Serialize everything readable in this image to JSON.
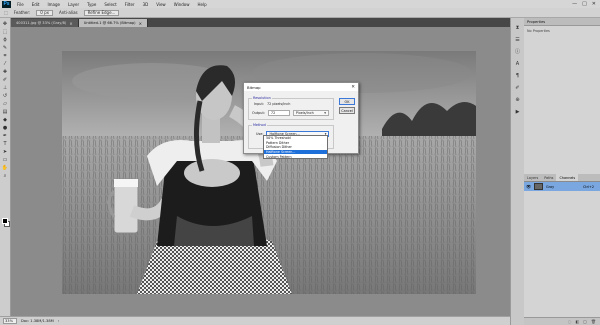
{
  "app": {
    "logo": "Ps"
  },
  "menu": [
    "File",
    "Edit",
    "Image",
    "Layer",
    "Type",
    "Select",
    "Filter",
    "3D",
    "View",
    "Window",
    "Help"
  ],
  "window_controls": [
    "—",
    "□",
    "✕"
  ],
  "options": {
    "feather_label": "Feather:",
    "feather_value": "0 px",
    "antialias_label": "Anti-alias",
    "refine_label": "Refine Edge..."
  },
  "tabs": [
    {
      "label": "400311.jpg @ 33% (Gray/8)",
      "close": "×"
    },
    {
      "label": "Untitled-1 @ 66.7% (Bitmap)",
      "close": "×"
    }
  ],
  "status": {
    "zoom": "33%",
    "doc": "Doc: 1.38M/1.38M",
    "arrow": "›"
  },
  "panels": {
    "properties_title": "Properties",
    "properties_empty": "No Properties",
    "layer_tabs": [
      "Layers",
      "Paths",
      "Channels"
    ],
    "channel": {
      "name": "Gray",
      "shortcut": "Ctrl+2",
      "eye": "👁"
    }
  },
  "dialog": {
    "title": "Bitmap",
    "close_glyph": "✕",
    "resolution_legend": "Resolution",
    "input_label": "Input:",
    "input_value": "72 pixels/inch",
    "output_label": "Output:",
    "output_value": "72",
    "output_units": "Pixels/Inch",
    "method_legend": "Method",
    "use_label": "Use:",
    "use_value": "Halftone Screen...",
    "ok_label": "OK",
    "cancel_label": "Cancel",
    "method_options": [
      "50% Threshold",
      "Pattern Dither",
      "Diffusion Dither",
      "Halftone Screen...",
      "Custom Pattern"
    ],
    "selected_option_index": 3
  },
  "colors": {
    "accent": "#1e6fd9",
    "menubar": "#d6d6d6",
    "canvas_bg": "#8b8b8b"
  }
}
